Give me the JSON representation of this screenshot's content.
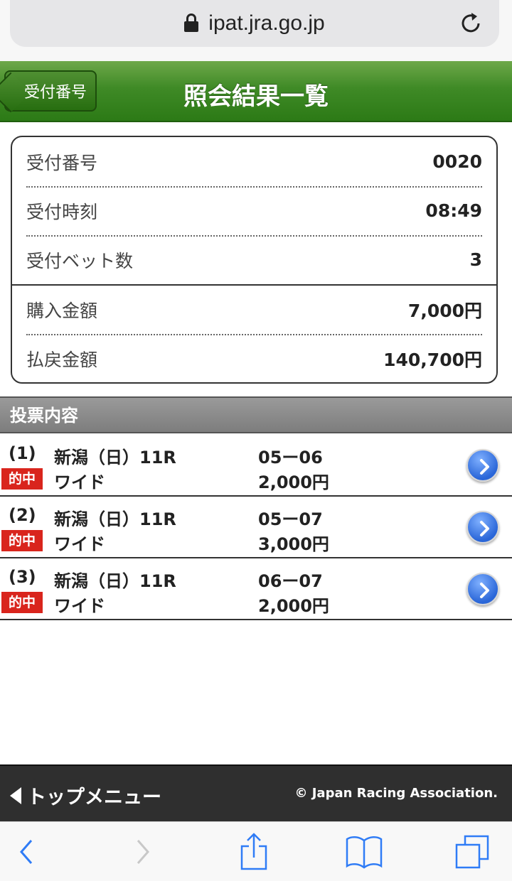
{
  "browser": {
    "url": "ipat.jra.go.jp",
    "icons": [
      "lock-icon",
      "reload-icon"
    ]
  },
  "header": {
    "back_label": "受付番号",
    "title": "照会結果一覧",
    "colors": {
      "accent": "#3f8a26"
    }
  },
  "summary": {
    "rows": [
      {
        "label": "受付番号",
        "value": "0020"
      },
      {
        "label": "受付時刻",
        "value": "08:49"
      },
      {
        "label": "受付ベット数",
        "value": "3"
      },
      {
        "label": "購入金額",
        "value": "7,000円"
      },
      {
        "label": "払戻金額",
        "value": "140,700円"
      }
    ]
  },
  "section_title": "投票内容",
  "bets": [
    {
      "num": "(1)",
      "race": "新潟（日）11R",
      "combo": "05ー06",
      "badge": "的中",
      "type": "ワイド",
      "amount": "2,000円"
    },
    {
      "num": "(2)",
      "race": "新潟（日）11R",
      "combo": "05ー07",
      "badge": "的中",
      "type": "ワイド",
      "amount": "3,000円"
    },
    {
      "num": "(3)",
      "race": "新潟（日）11R",
      "combo": "06ー07",
      "badge": "的中",
      "type": "ワイド",
      "amount": "2,000円"
    }
  ],
  "footer": {
    "menu_label": "トップメニュー",
    "copyright": "© Japan Racing Association."
  },
  "toolbar": {
    "icons": [
      "back-icon",
      "forward-icon",
      "share-icon",
      "bookmarks-icon",
      "tabs-icon"
    ]
  }
}
